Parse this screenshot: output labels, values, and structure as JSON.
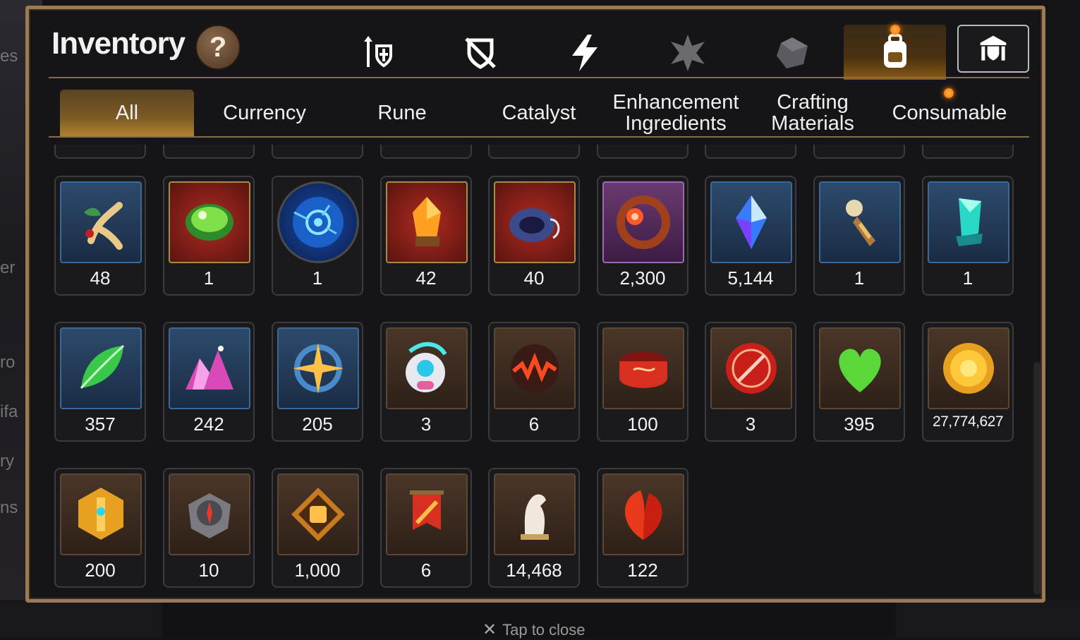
{
  "panel": {
    "title": "Inventory",
    "help_label": "?"
  },
  "category_icons": [
    {
      "name": "weapon-armor-icon"
    },
    {
      "name": "shield-crossed-icon"
    },
    {
      "name": "lightning-icon"
    },
    {
      "name": "artifact-icon"
    },
    {
      "name": "box-icon"
    },
    {
      "name": "backpack-icon",
      "active": true
    },
    {
      "name": "castle-shield-icon"
    }
  ],
  "tabs": [
    {
      "label": "All",
      "active": true
    },
    {
      "label": "Currency"
    },
    {
      "label": "Rune"
    },
    {
      "label": "Catalyst"
    },
    {
      "label": "Enhancement Ingredients"
    },
    {
      "label": "Crafting Materials"
    },
    {
      "label": "Consumable"
    }
  ],
  "items": [
    {
      "icon": "ginseng-root-icon",
      "count": "48",
      "frame": "blue"
    },
    {
      "icon": "green-orb-icon",
      "count": "1",
      "frame": "red"
    },
    {
      "icon": "blue-rune-sphere-icon",
      "count": "1",
      "frame": "round"
    },
    {
      "icon": "orange-crystal-icon",
      "count": "42",
      "frame": "red"
    },
    {
      "icon": "bracelet-icon",
      "count": "40",
      "frame": "red"
    },
    {
      "icon": "flower-ring-icon",
      "count": "2,300",
      "frame": "purple"
    },
    {
      "icon": "blue-gem-icon",
      "count": "5,144",
      "frame": "blue"
    },
    {
      "icon": "bookmark-charm-icon",
      "count": "1",
      "frame": "blue"
    },
    {
      "icon": "teal-crystal-icon",
      "count": "1",
      "frame": "blue"
    },
    {
      "icon": "green-leaf-icon",
      "count": "357",
      "frame": "blue"
    },
    {
      "icon": "pink-crystal-pile-icon",
      "count": "242",
      "frame": "blue"
    },
    {
      "icon": "compass-star-icon",
      "count": "205",
      "frame": "blue"
    },
    {
      "icon": "robot-pet-icon",
      "count": "3",
      "frame": "brown"
    },
    {
      "icon": "lava-orb-icon",
      "count": "6",
      "frame": "brown"
    },
    {
      "icon": "red-band-icon",
      "count": "100",
      "frame": "brown"
    },
    {
      "icon": "red-seal-icon",
      "count": "3",
      "frame": "brown"
    },
    {
      "icon": "green-heart-icon",
      "count": "395",
      "frame": "brown"
    },
    {
      "icon": "gold-coin-icon",
      "count": "27,774,627",
      "frame": "brown",
      "small": true
    },
    {
      "icon": "gold-hexagon-emblem-icon",
      "count": "200",
      "frame": "brown"
    },
    {
      "icon": "stone-compass-icon",
      "count": "10",
      "frame": "brown"
    },
    {
      "icon": "fist-emblem-icon",
      "count": "1,000",
      "frame": "brown"
    },
    {
      "icon": "war-banner-icon",
      "count": "6",
      "frame": "brown"
    },
    {
      "icon": "horse-chess-piece-icon",
      "count": "14,468",
      "frame": "brown"
    },
    {
      "icon": "red-leaf-icon",
      "count": "122",
      "frame": "brown"
    }
  ],
  "footer": {
    "close_label": "Tap to close"
  },
  "colors": {
    "border": "#9a7b54",
    "active_tab": "#b08330",
    "panel_bg": "#151517"
  }
}
